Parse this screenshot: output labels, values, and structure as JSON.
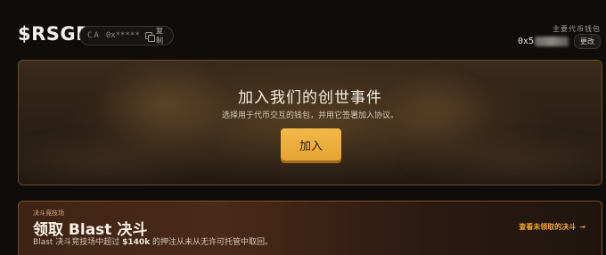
{
  "header": {
    "logo": "$RSGP",
    "ca": {
      "label": "CA",
      "value": "0x*****",
      "copy_label": "复制"
    },
    "wallet": {
      "label": "主要代币钱包",
      "address_prefix": "0x5",
      "change_label": "更改"
    }
  },
  "join": {
    "title": "加入我们的创世事件",
    "subtitle": "选择用于代币交互的钱包，并用它签署加入协议。",
    "button_label": "加入"
  },
  "blast": {
    "kicker": "决斗竞技场",
    "title": "领取 Blast 决斗",
    "desc_prefix": "Blast 决斗竞技场中超过 ",
    "desc_amount": "$140k",
    "desc_suffix": " 的押注从未从无许可托管中取回。",
    "link_label": "查看未领取的决斗",
    "link_arrow": "→"
  },
  "colors": {
    "accent": "#f2b94a",
    "link": "#f0a436",
    "background": "#0e0d0c"
  }
}
